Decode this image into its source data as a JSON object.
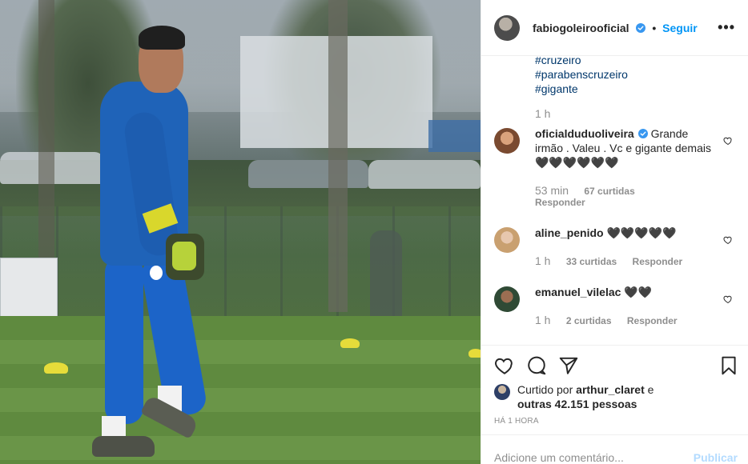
{
  "header": {
    "username": "fabiogoleirooficial",
    "separator": "•",
    "follow_label": "Seguir",
    "more_label": "•••"
  },
  "caption": {
    "hashtags": [
      "#cruzeiro",
      "#parabenscruzeiro",
      "#gigante"
    ],
    "time": "1 h"
  },
  "comments": [
    {
      "username": "oficialduduoliveira",
      "verified": true,
      "text": "Grande irmão . Valeu . Vc e gigante demais 🖤🖤🖤🖤🖤🖤",
      "time": "53 min",
      "likes": "67 curtidas",
      "reply": "Responder"
    },
    {
      "username": "aline_penido",
      "verified": false,
      "text": "🖤🖤🖤🖤🖤",
      "time": "1 h",
      "likes": "33 curtidas",
      "reply": "Responder"
    },
    {
      "username": "emanuel_vilelac",
      "verified": false,
      "text": "🖤🖤",
      "time": "1 h",
      "likes": "2 curtidas",
      "reply": "Responder"
    }
  ],
  "likes": {
    "prefix": "Curtido por",
    "user": "arthur_claret",
    "conj": "e",
    "others": "outras 42.151 pessoas"
  },
  "posted_ago": "HÁ 1 HORA",
  "add_comment": {
    "placeholder": "Adicione um comentário...",
    "publish_label": "Publicar"
  },
  "colors": {
    "link_blue": "#0095f6",
    "hashtag": "#00376b",
    "muted": "#8e8e8e",
    "publish_disabled": "#b3dbff"
  },
  "icons": [
    "verified-badge-icon",
    "heart-icon",
    "comment-icon",
    "share-icon",
    "bookmark-icon",
    "more-options-icon"
  ]
}
